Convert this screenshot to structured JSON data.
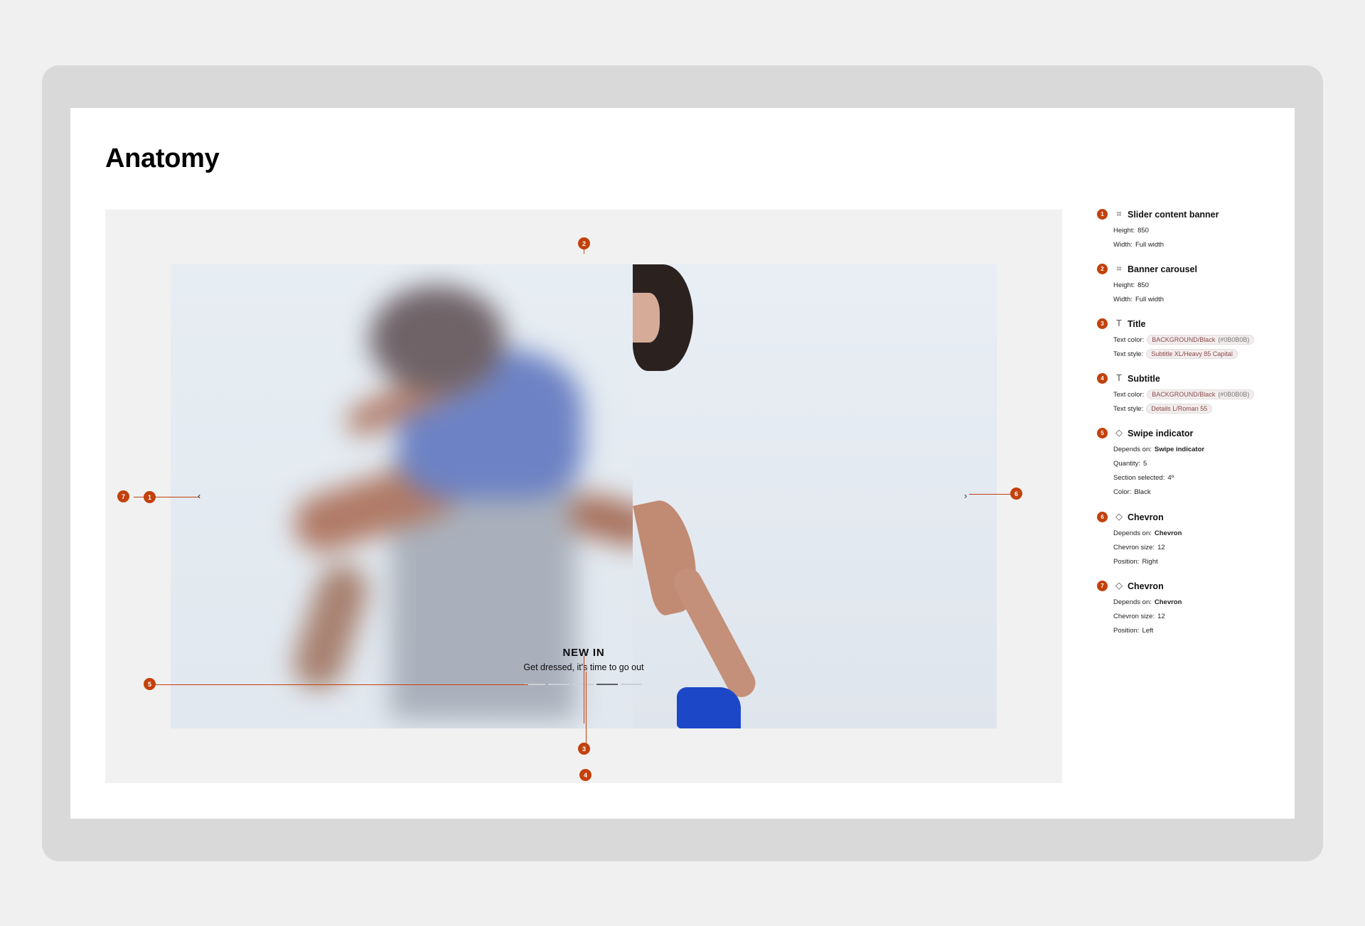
{
  "page": {
    "title": "Anatomy"
  },
  "banner": {
    "title": "NEW IN",
    "subtitle": "Get dressed, it's time to go out",
    "swipe": {
      "count": 5,
      "selected": 4
    },
    "chevron_left": "‹",
    "chevron_right": "›"
  },
  "markers": {
    "m1": "1",
    "m2": "2",
    "m3": "3",
    "m4": "4",
    "m5": "5",
    "m6": "6",
    "m7": "7"
  },
  "accent_color": "#c2410c",
  "spec": [
    {
      "num": "1",
      "icon": "frame-icon",
      "glyph": "⌗",
      "name": "Slider content banner",
      "rows": [
        {
          "key": "Height:",
          "val": "850"
        },
        {
          "key": "Width:",
          "val": "Full width"
        }
      ]
    },
    {
      "num": "2",
      "icon": "frame-icon",
      "glyph": "⌗",
      "name": "Banner carousel",
      "rows": [
        {
          "key": "Height:",
          "val": "850"
        },
        {
          "key": "Width:",
          "val": "Full width"
        }
      ]
    },
    {
      "num": "3",
      "icon": "text-icon",
      "glyph": "T",
      "name": "Title",
      "rows": [
        {
          "key": "Text color:",
          "chip": "BACKGROUND/Black",
          "chip_hex": "(#0B0B0B)"
        },
        {
          "key": "Text style:",
          "chip": "Subtitle XL/Heavy 85 Capital"
        }
      ]
    },
    {
      "num": "4",
      "icon": "text-icon",
      "glyph": "T",
      "name": "Subtitle",
      "rows": [
        {
          "key": "Text color:",
          "chip": "BACKGROUND/Black",
          "chip_hex": "(#0B0B0B)"
        },
        {
          "key": "Text style:",
          "chip": "Details L/Roman 55"
        }
      ]
    },
    {
      "num": "5",
      "icon": "component-icon",
      "glyph": "◇",
      "name": "Swipe indicator",
      "rows": [
        {
          "key": "Depends on:",
          "bold": "Swipe indicator"
        },
        {
          "key": "Quantity:",
          "val": "5"
        },
        {
          "key": "Section selected:",
          "val": "4º"
        },
        {
          "key": "Color:",
          "val": "Black"
        }
      ]
    },
    {
      "num": "6",
      "icon": "component-icon",
      "glyph": "◇",
      "name": "Chevron",
      "rows": [
        {
          "key": "Depends on:",
          "bold": "Chevron"
        },
        {
          "key": "Chevron size:",
          "val": "12"
        },
        {
          "key": "Position:",
          "val": "Right"
        }
      ]
    },
    {
      "num": "7",
      "icon": "component-icon",
      "glyph": "◇",
      "name": "Chevron",
      "rows": [
        {
          "key": "Depends on:",
          "bold": "Chevron"
        },
        {
          "key": "Chevron size:",
          "val": "12"
        },
        {
          "key": "Position:",
          "val": "Left"
        }
      ]
    }
  ]
}
